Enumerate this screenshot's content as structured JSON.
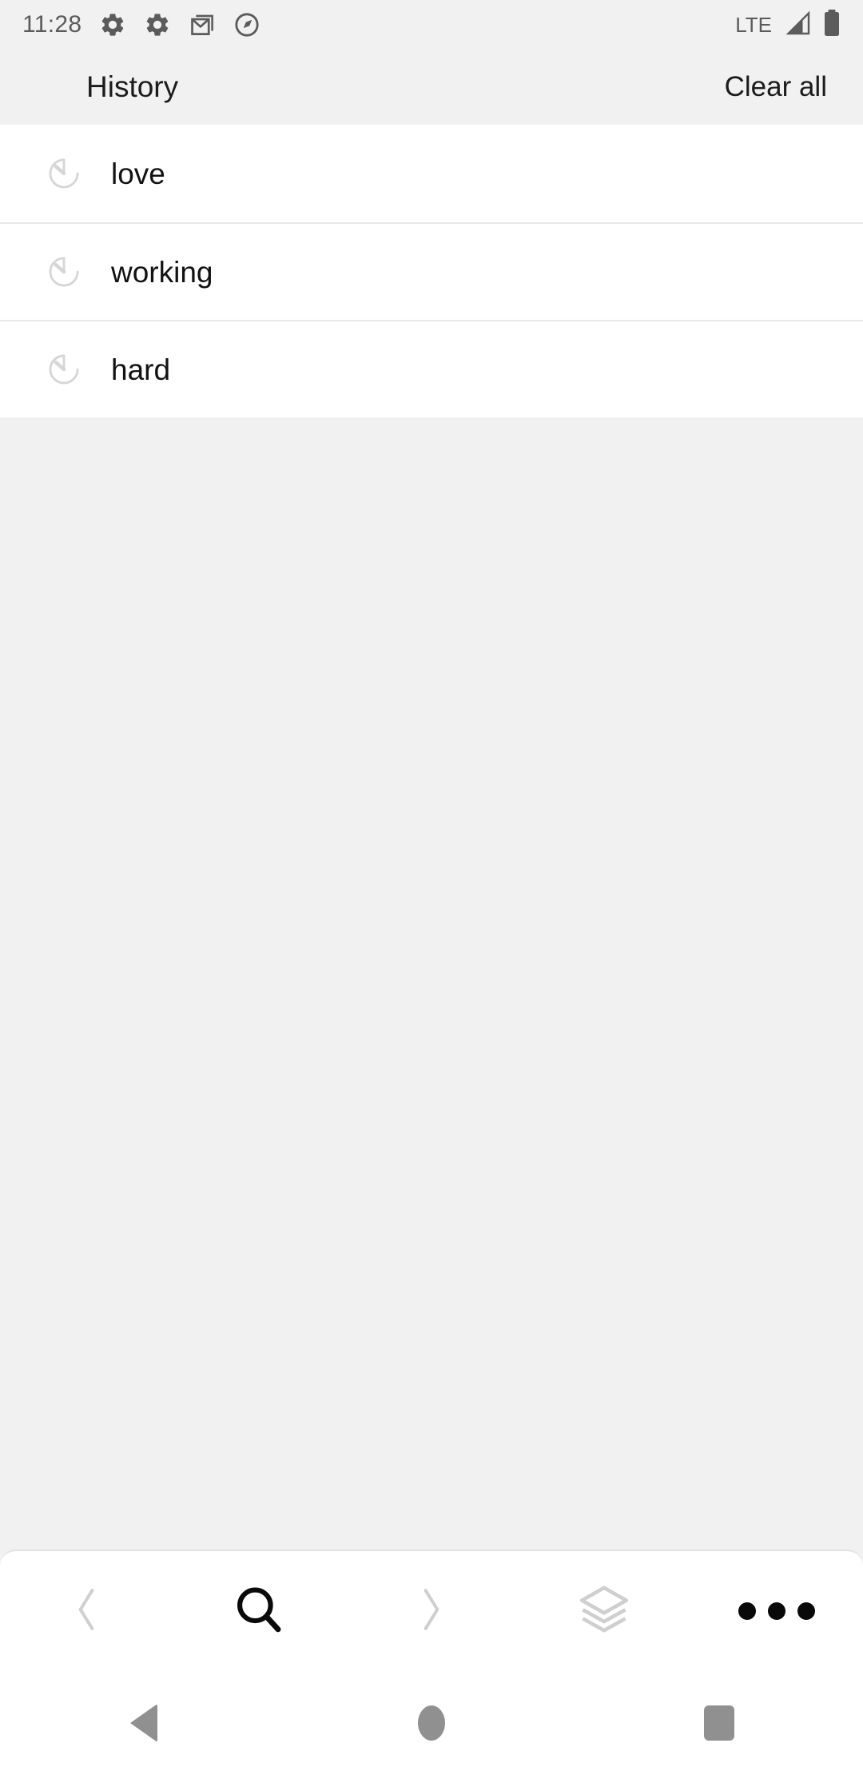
{
  "status_bar": {
    "clock": "11:28",
    "left_icons": [
      {
        "name": "settings-gear-icon"
      },
      {
        "name": "settings-gear-icon"
      },
      {
        "name": "gmail-icon"
      },
      {
        "name": "compass-navigation-icon"
      }
    ],
    "network_label": "LTE",
    "right_icons": [
      {
        "name": "signal-strength-icon"
      },
      {
        "name": "battery-full-icon"
      }
    ],
    "colors": {
      "text": "#5b5b5b",
      "background": "#f1f1f1"
    }
  },
  "header": {
    "title": "History",
    "clear_all_label": "Clear all",
    "background": "#f1f1f1"
  },
  "history": {
    "row_icon_name": "history-clock-icon",
    "items": [
      {
        "label": "love"
      },
      {
        "label": "working"
      },
      {
        "label": "hard"
      }
    ]
  },
  "toolbar": {
    "buttons": [
      {
        "name": "back-chevron-icon",
        "label": "Back",
        "enabled": false
      },
      {
        "name": "search-icon",
        "label": "Search",
        "enabled": true
      },
      {
        "name": "forward-chevron-icon",
        "label": "Forward",
        "enabled": false
      },
      {
        "name": "tabs-layers-icon",
        "label": "Tabs",
        "enabled": true
      },
      {
        "name": "more-options-icon",
        "label": "More options",
        "enabled": true
      }
    ]
  },
  "nav_bar": {
    "buttons": [
      {
        "name": "android-back-button",
        "label": "Back"
      },
      {
        "name": "android-home-button",
        "label": "Home"
      },
      {
        "name": "android-recents-button",
        "label": "Recent apps"
      }
    ],
    "icon_color": "#909090"
  },
  "colors": {
    "page_background": "#f1f1f1",
    "list_background": "#ffffff",
    "divider": "#e9e9e9",
    "primary_text": "#121212",
    "muted_icon": "#d2d2d2",
    "nav_icon": "#909090"
  }
}
